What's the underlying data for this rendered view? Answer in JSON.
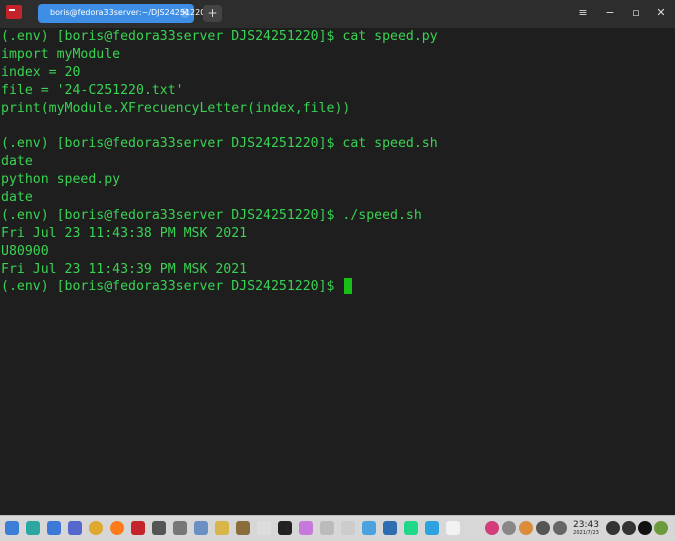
{
  "tab": {
    "title": "boris@fedora33server:~/DJS24251220",
    "close": "×"
  },
  "new_tab": "+",
  "window": {
    "menu": "≡",
    "minimize": "−",
    "maximize": "▫",
    "close": "✕"
  },
  "terminal": {
    "lines": [
      "(.env) [boris@fedora33server DJS24251220]$ cat speed.py",
      "import myModule",
      "index = 20",
      "file = '24-C251220.txt'",
      "print(myModule.XFrecuencyLetter(index,file))",
      "",
      "(.env) [boris@fedora33server DJS24251220]$ cat speed.sh",
      "date",
      "python speed.py",
      "date",
      "(.env) [boris@fedora33server DJS24251220]$ ./speed.sh",
      "Fri Jul 23 11:43:38 PM MSK 2021",
      "U80900",
      "Fri Jul 23 11:43:39 PM MSK 2021"
    ],
    "prompt": "(.env) [boris@fedora33server DJS24251220]$ "
  },
  "taskbar": {
    "apps": [
      {
        "name": "launcher-icon",
        "color": "#3d7fd6"
      },
      {
        "name": "files-icon",
        "color": "#2aa7a0"
      },
      {
        "name": "store-icon",
        "color": "#3c78d8"
      },
      {
        "name": "settings-icon",
        "color": "#5566cc"
      },
      {
        "name": "chrome-icon",
        "color": "#e0a82e"
      },
      {
        "name": "firefox-icon",
        "color": "#ff7a1a"
      },
      {
        "name": "terminal-icon",
        "color": "#c4232b"
      },
      {
        "name": "vm-icon",
        "color": "#555555"
      },
      {
        "name": "mail-icon",
        "color": "#777777"
      },
      {
        "name": "web-icon",
        "color": "#6a8fc4"
      },
      {
        "name": "notes-icon",
        "color": "#d9b54a"
      },
      {
        "name": "gimp-icon",
        "color": "#8a6d3b"
      },
      {
        "name": "text-editor-icon",
        "color": "#dddddd"
      },
      {
        "name": "intellij-icon",
        "color": "#222222"
      },
      {
        "name": "monitor-icon",
        "color": "#c678dd"
      },
      {
        "name": "audio-icon",
        "color": "#bbbbbb"
      },
      {
        "name": "music-icon",
        "color": "#cccccc"
      },
      {
        "name": "photos-icon",
        "color": "#4aa3df"
      },
      {
        "name": "mail2-icon",
        "color": "#2f6db3"
      },
      {
        "name": "pycharm-icon",
        "color": "#21d789"
      },
      {
        "name": "telegram-icon",
        "color": "#2aa3e0"
      },
      {
        "name": "calendar-icon",
        "color": "#f2f2f2"
      }
    ],
    "tray": [
      {
        "name": "network-icon",
        "color": "#d33c7a"
      },
      {
        "name": "keyboard-icon",
        "color": "#888888"
      },
      {
        "name": "status-icon",
        "color": "#d98c3a"
      },
      {
        "name": "tools-icon",
        "color": "#555555"
      },
      {
        "name": "bluetooth-icon",
        "color": "#666666"
      }
    ],
    "clock_time": "23:43",
    "clock_date": "2021/7/23",
    "tray_right": [
      {
        "name": "notification-icon",
        "color": "#333333"
      },
      {
        "name": "mute-icon",
        "color": "#333333"
      },
      {
        "name": "power-icon",
        "color": "#111111"
      },
      {
        "name": "assistant-icon",
        "color": "#6a9a3a"
      }
    ]
  }
}
